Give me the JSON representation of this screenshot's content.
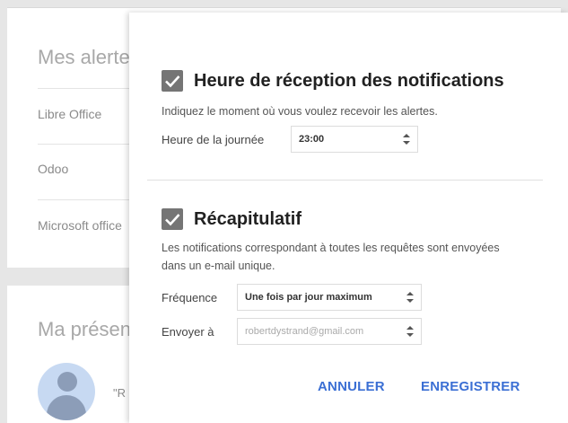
{
  "background": {
    "alerts_title": "Mes alertes",
    "alert_items": [
      "Libre Office",
      "Odoo",
      "Microsoft office"
    ],
    "presentation_title": "Ma présentation",
    "quote_text": "\"R"
  },
  "dialog": {
    "notif_section": {
      "title": "Heure de réception des notifications",
      "description": "Indiquez le moment où vous voulez recevoir les alertes.",
      "time_label": "Heure de la journée",
      "time_value": "23:00"
    },
    "summary_section": {
      "title": "Récapitulatif",
      "description": "Les notifications correspondant à toutes les requêtes sont envoyées dans un e-mail unique.",
      "frequency_label": "Fréquence",
      "frequency_value": "Une fois par jour maximum",
      "send_to_label": "Envoyer à",
      "send_to_value": "robertdystrand@gmail.com"
    },
    "actions": {
      "cancel_label": "ANNULER",
      "save_label": "ENREGISTRER"
    }
  },
  "colors": {
    "accent": "#3b6fd4",
    "checkbox": "#757575"
  }
}
